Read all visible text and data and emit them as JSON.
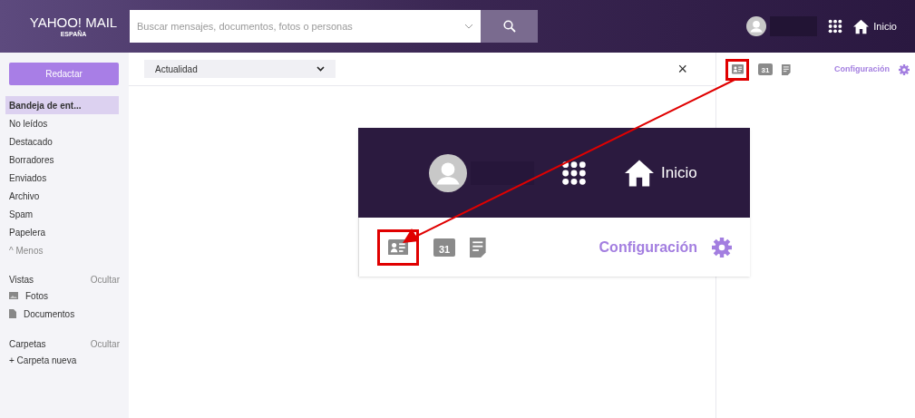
{
  "header": {
    "logo": "YAHOO! MAIL",
    "logo_region": "ESPAÑA",
    "search": {
      "placeholder": "Buscar mensajes, documentos, fotos o personas"
    },
    "home": "Inicio"
  },
  "sidebar": {
    "compose": "Redactar",
    "folders": [
      {
        "label": "Bandeja de ent...",
        "selected": true
      },
      {
        "label": "No leídos",
        "selected": false
      },
      {
        "label": "Destacado",
        "selected": false
      },
      {
        "label": "Borradores",
        "selected": false
      },
      {
        "label": "Enviados",
        "selected": false
      },
      {
        "label": "Archivo",
        "selected": false
      },
      {
        "label": "Spam",
        "selected": false
      },
      {
        "label": "Papelera",
        "selected": false
      }
    ],
    "less": "^ Menos",
    "views": {
      "title": "Vistas",
      "toggle": "Ocultar",
      "items": [
        {
          "kind": "photos",
          "label": "Fotos"
        },
        {
          "kind": "documents",
          "label": "Documentos"
        }
      ]
    },
    "folders_section": {
      "title": "Carpetas",
      "toggle": "Ocultar",
      "new": "+ Carpeta nueva"
    }
  },
  "main": {
    "filter": "Actualidad",
    "close": "×"
  },
  "right_pane": {
    "calendar_day": "31",
    "settings": "Configuración"
  },
  "inset": {
    "home": "Inicio",
    "calendar_day": "31",
    "settings": "Configuración"
  }
}
